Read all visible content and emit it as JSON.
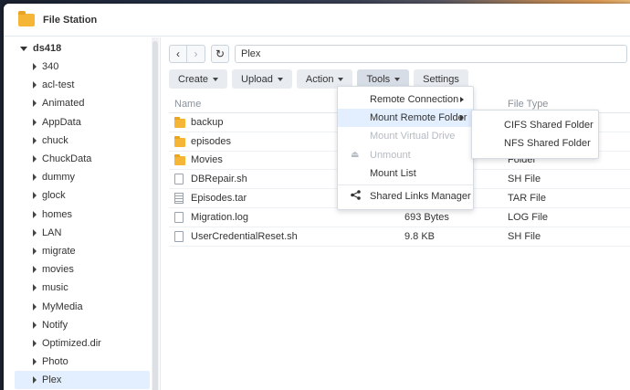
{
  "window": {
    "title": "File Station"
  },
  "sidebar": {
    "root": "ds418",
    "items": [
      "340",
      "acl-test",
      "Animated",
      "AppData",
      "chuck",
      "ChuckData",
      "dummy",
      "glock",
      "homes",
      "LAN",
      "migrate",
      "movies",
      "music",
      "MyMedia",
      "Notify",
      "Optimized.dir",
      "Photo",
      "Plex"
    ],
    "selected": "Plex"
  },
  "nav": {
    "back": "‹",
    "forward": "›",
    "refresh": "↻",
    "path": "Plex"
  },
  "toolbar": {
    "create": "Create",
    "upload": "Upload",
    "action": "Action",
    "tools": "Tools",
    "settings": "Settings"
  },
  "table": {
    "headers": {
      "name": "Name",
      "size": "",
      "type": "File Type"
    },
    "rows": [
      {
        "name": "backup",
        "size": "",
        "type": "",
        "icon": "folder"
      },
      {
        "name": "episodes",
        "size": "",
        "type": "",
        "icon": "folder"
      },
      {
        "name": "Movies",
        "size": "",
        "type": "Folder",
        "icon": "folder"
      },
      {
        "name": "DBRepair.sh",
        "size": "",
        "type": "SH File",
        "icon": "file"
      },
      {
        "name": "Episodes.tar",
        "size": "",
        "type": "TAR File",
        "icon": "zip"
      },
      {
        "name": "Migration.log",
        "size": "693 Bytes",
        "type": "LOG File",
        "icon": "file"
      },
      {
        "name": "UserCredentialReset.sh",
        "size": "9.8 KB",
        "type": "SH File",
        "icon": "file"
      }
    ]
  },
  "tools_menu": {
    "remote_connection": "Remote Connection",
    "mount_remote_folder": "Mount Remote Folder",
    "mount_virtual_drive": "Mount Virtual Drive",
    "unmount": "Unmount",
    "mount_list": "Mount List",
    "shared_links_manager": "Shared Links Manager"
  },
  "mount_submenu": {
    "cifs": "CIFS Shared Folder",
    "nfs": "NFS Shared Folder"
  }
}
